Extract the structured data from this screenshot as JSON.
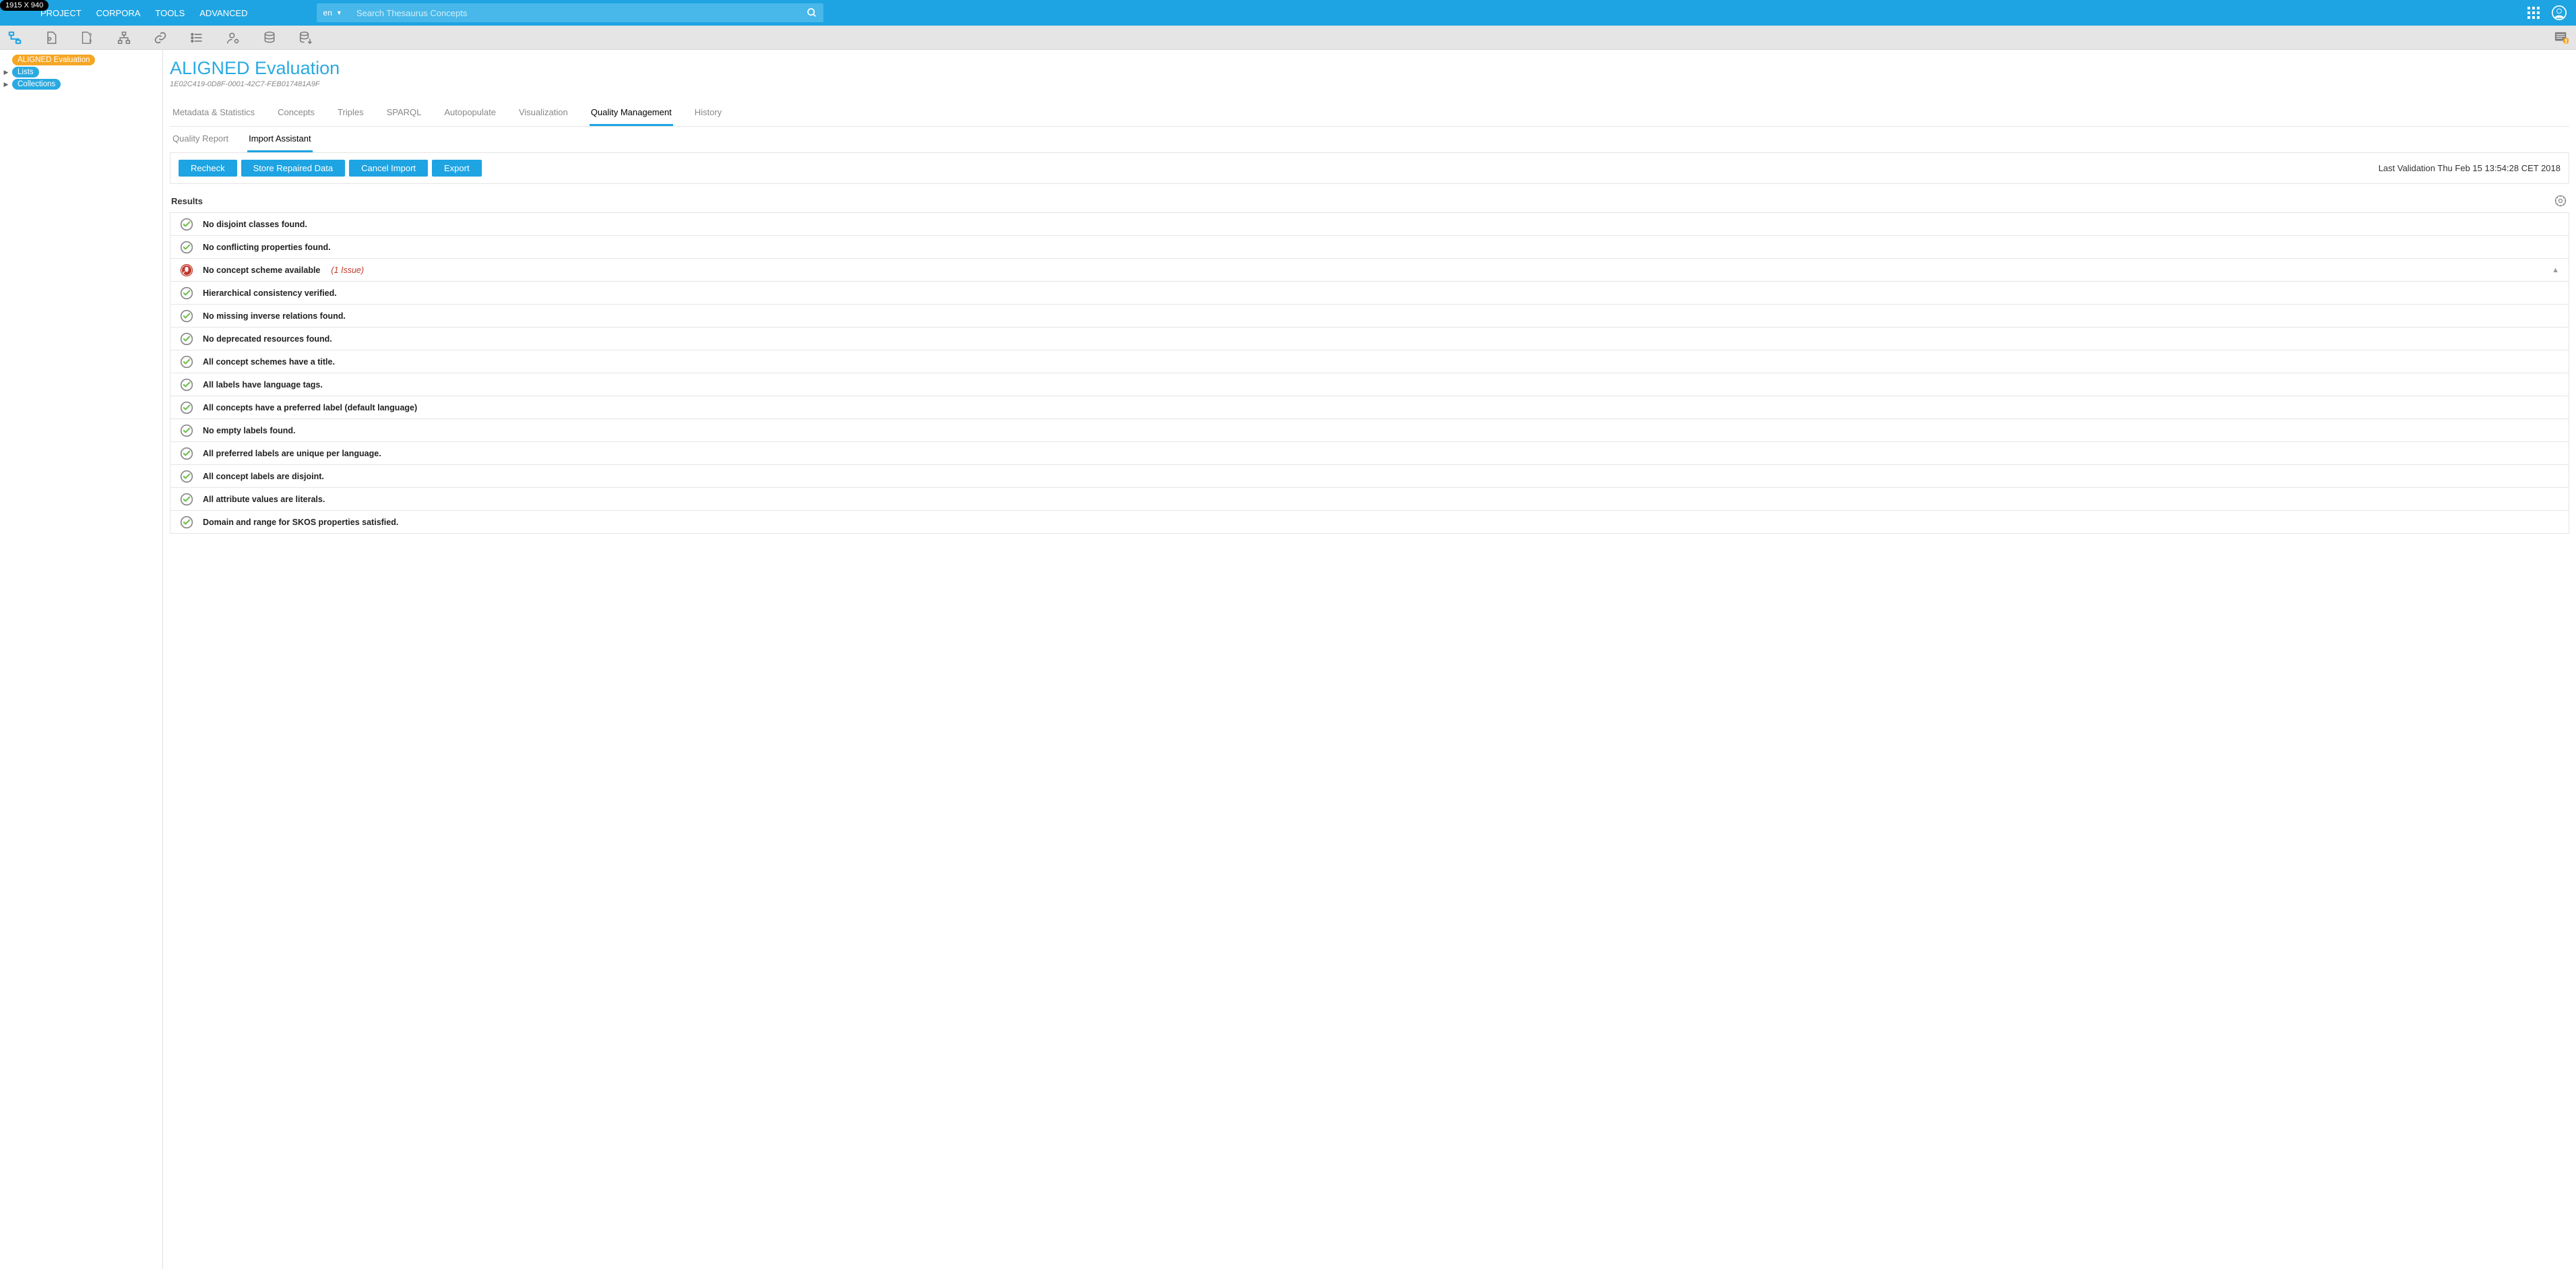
{
  "dim_badge": "1915 X 940",
  "topnav": {
    "items": [
      "PROJECT",
      "CORPORA",
      "TOOLS",
      "ADVANCED"
    ]
  },
  "search": {
    "lang": "en",
    "placeholder": "Search Thesaurus Concepts"
  },
  "tree": {
    "root_label": "ALIGNED Evaluation",
    "lists_label": "Lists",
    "collections_label": "Collections"
  },
  "page": {
    "title": "ALIGNED Evaluation",
    "uri": "1E02C419-0D8F-0001-42C7-FEB017481A9F"
  },
  "tabs": [
    "Metadata & Statistics",
    "Concepts",
    "Triples",
    "SPARQL",
    "Autopopulate",
    "Visualization",
    "Quality Management",
    "History"
  ],
  "tabs_active_index": 6,
  "subtabs": [
    "Quality Report",
    "Import Assistant"
  ],
  "subtabs_active_index": 1,
  "actions": {
    "recheck": "Recheck",
    "store": "Store Repaired Data",
    "cancel": "Cancel Import",
    "export": "Export",
    "last_validation": "Last Validation Thu Feb 15 13:54:28 CET 2018"
  },
  "results_title": "Results",
  "issue_suffix_template": "(1 Issue)",
  "results": [
    {
      "status": "ok",
      "label": "No disjoint classes found."
    },
    {
      "status": "ok",
      "label": "No conflicting properties found."
    },
    {
      "status": "error",
      "label": "No concept scheme available",
      "issues": 1,
      "expandable": true
    },
    {
      "status": "ok",
      "label": "Hierarchical consistency verified."
    },
    {
      "status": "ok",
      "label": "No missing inverse relations found."
    },
    {
      "status": "ok",
      "label": "No deprecated resources found."
    },
    {
      "status": "ok",
      "label": "All concept schemes have a title."
    },
    {
      "status": "ok",
      "label": "All labels have language tags."
    },
    {
      "status": "ok",
      "label": "All concepts have a preferred label (default language)"
    },
    {
      "status": "ok",
      "label": "No empty labels found."
    },
    {
      "status": "ok",
      "label": "All preferred labels are unique per language."
    },
    {
      "status": "ok",
      "label": "All concept labels are disjoint."
    },
    {
      "status": "ok",
      "label": "All attribute values are literals."
    },
    {
      "status": "ok",
      "label": "Domain and range for SKOS properties satisfied."
    }
  ]
}
